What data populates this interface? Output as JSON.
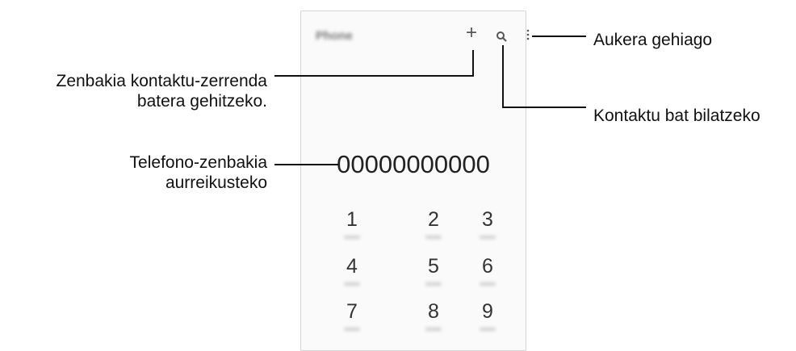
{
  "phone": {
    "app_title": "Phone",
    "dialed_number": "00000000000",
    "keys": [
      "1",
      "2",
      "3",
      "4",
      "5",
      "6",
      "7",
      "8",
      "9"
    ],
    "icons": {
      "add": "plus-icon",
      "search": "search-icon",
      "more": "more-vertical-icon"
    }
  },
  "callouts": {
    "more_options": "Aukera gehiago",
    "search_contact": "Kontaktu bat bilatzeko",
    "add_contact_line1": "Zenbakia kontaktu-zerrenda",
    "add_contact_line2": "batera gehitzeko.",
    "preview_line1": "Telefono-zenbakia",
    "preview_line2": "aurreikusteko"
  }
}
